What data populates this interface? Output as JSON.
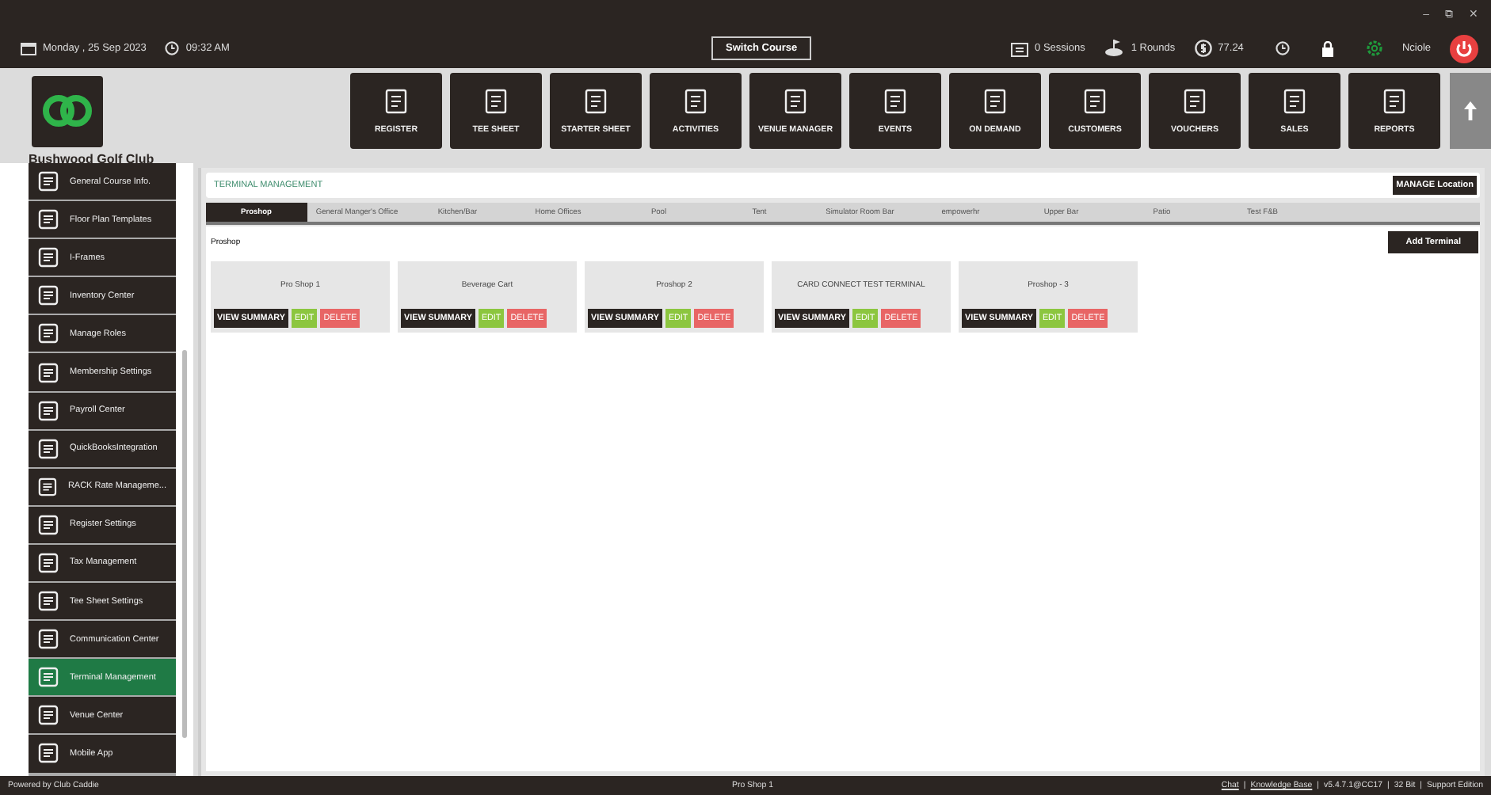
{
  "window_controls": [
    "–",
    "⧉",
    "✕"
  ],
  "info_bar": {
    "date": "Monday ,  25 Sep 2023",
    "time": "09:32 AM",
    "switch_course": "Switch Course",
    "sessions": "0 Sessions",
    "rounds": "1 Rounds",
    "balance": "77.24",
    "user": "Nciole"
  },
  "club_name": "Bushwood Golf Club",
  "nav_tiles": [
    "REGISTER",
    "TEE SHEET",
    "STARTER SHEET",
    "ACTIVITIES",
    "VENUE MANAGER",
    "EVENTS",
    "ON DEMAND",
    "CUSTOMERS",
    "VOUCHERS",
    "SALES",
    "REPORTS"
  ],
  "sidebar": {
    "items": [
      {
        "label": "General Course Info.",
        "selected": false
      },
      {
        "label": "Floor Plan Templates",
        "selected": false
      },
      {
        "label": "I-Frames",
        "selected": false
      },
      {
        "label": "Inventory Center",
        "selected": false
      },
      {
        "label": "Manage Roles",
        "selected": false
      },
      {
        "label": "Membership Settings",
        "selected": false
      },
      {
        "label": "Payroll Center",
        "selected": false
      },
      {
        "label": "QuickBooksIntegration",
        "selected": false
      },
      {
        "label": "RACK Rate Manageme...",
        "selected": false
      },
      {
        "label": "Register Settings",
        "selected": false
      },
      {
        "label": "Tax Management",
        "selected": false
      },
      {
        "label": "Tee Sheet Settings",
        "selected": false
      },
      {
        "label": "Communication Center",
        "selected": false
      },
      {
        "label": "Terminal Management",
        "selected": true
      },
      {
        "label": "Venue Center",
        "selected": false
      },
      {
        "label": "Mobile App",
        "selected": false
      }
    ]
  },
  "page": {
    "title": "TERMINAL MANAGEMENT",
    "manage_button": "MANAGE Location",
    "tabs": [
      {
        "label": "Proshop",
        "selected": true
      },
      {
        "label": "General Manger's Office",
        "selected": false
      },
      {
        "label": "Kitchen/Bar",
        "selected": false
      },
      {
        "label": "Home Offices",
        "selected": false
      },
      {
        "label": "Pool",
        "selected": false
      },
      {
        "label": "Tent",
        "selected": false
      },
      {
        "label": "Simulator Room Bar",
        "selected": false
      },
      {
        "label": "empowerhr",
        "selected": false
      },
      {
        "label": "Upper Bar",
        "selected": false
      },
      {
        "label": "Patio",
        "selected": false
      },
      {
        "label": "Test F&B",
        "selected": false
      }
    ],
    "section_title": "Proshop",
    "add_button": "Add Terminal",
    "terminals": [
      {
        "name": "Pro Shop 1",
        "view": "VIEW SUMMARY",
        "edit": "EDIT",
        "delete": "DELETE"
      },
      {
        "name": "Beverage Cart",
        "view": "VIEW SUMMARY",
        "edit": "EDIT",
        "delete": "DELETE"
      },
      {
        "name": "Proshop 2",
        "view": "VIEW SUMMARY",
        "edit": "EDIT",
        "delete": "DELETE"
      },
      {
        "name": "CARD CONNECT TEST TERMINAL",
        "view": "VIEW SUMMARY",
        "edit": "EDIT",
        "delete": "DELETE"
      },
      {
        "name": "Proshop - 3",
        "view": "VIEW SUMMARY",
        "edit": "EDIT",
        "delete": "DELETE"
      }
    ]
  },
  "status_bar": {
    "powered_by": "Powered by Club Caddie",
    "terminal": "Pro Shop 1",
    "links": [
      "Chat",
      "Knowledge Base"
    ],
    "info": [
      "v5.4.7.1@CC17",
      "32 Bit",
      "Support Edition"
    ],
    "separator": "|"
  }
}
